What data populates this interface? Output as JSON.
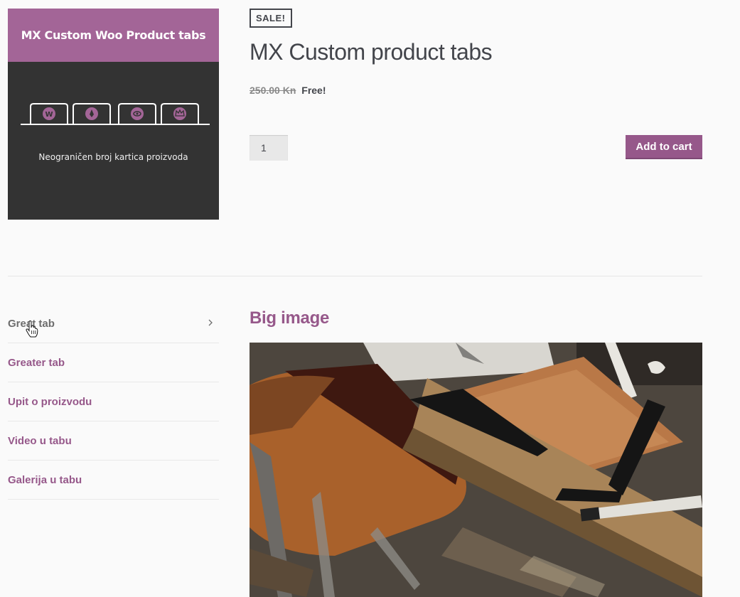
{
  "product_image": {
    "banner_text": "MX Custom Woo Product tabs",
    "caption": "Neograničen broj kartica proizvoda",
    "icons": [
      "wordpress-icon",
      "rocket-icon",
      "eye-icon",
      "crown-icon"
    ],
    "colors": {
      "banner": "#a36597",
      "background": "#333333"
    }
  },
  "summary": {
    "badge": "SALE!",
    "title": "MX Custom product tabs",
    "old_price": "250.00 Kn",
    "new_price": "Free!",
    "quantity": "1",
    "add_to_cart": "Add to cart"
  },
  "tabs": [
    {
      "label": "Great tab",
      "active": true
    },
    {
      "label": "Greater tab",
      "active": false
    },
    {
      "label": "Upit o proizvodu",
      "active": false
    },
    {
      "label": "Video u tabu",
      "active": false
    },
    {
      "label": "Galerija u tabu",
      "active": false
    }
  ],
  "panel": {
    "heading": "Big image"
  },
  "colors": {
    "accent": "#96588a",
    "text": "#43454b"
  }
}
